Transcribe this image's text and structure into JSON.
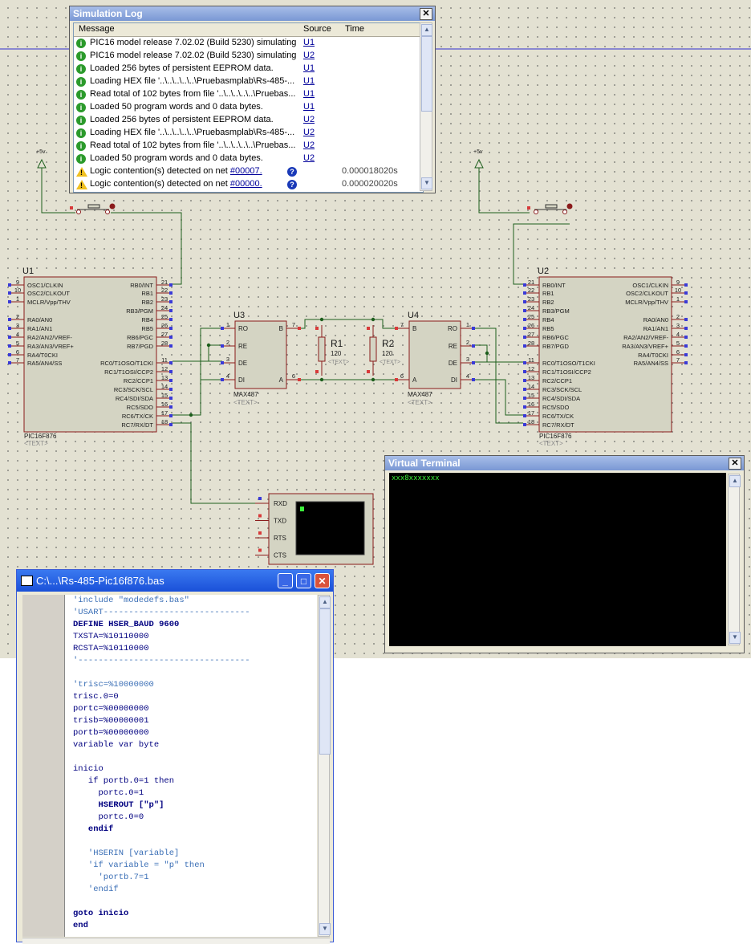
{
  "simlog": {
    "title": "Simulation Log",
    "headers": {
      "message": "Message",
      "source": "Source",
      "time": "Time"
    },
    "rows": [
      {
        "type": "info",
        "message": "PIC16 model release 7.02.02 (Build 5230) simulating ...",
        "source": "U1",
        "time": ""
      },
      {
        "type": "info",
        "message": "PIC16 model release 7.02.02 (Build 5230) simulating ...",
        "source": "U2",
        "time": ""
      },
      {
        "type": "info",
        "message": "Loaded 256 bytes of persistent EEPROM data.",
        "source": "U1",
        "time": ""
      },
      {
        "type": "info",
        "message": "Loading HEX file '..\\..\\..\\..\\..\\Pruebasmplab\\Rs-485-...",
        "source": "U1",
        "time": ""
      },
      {
        "type": "info",
        "message": "Read total of 102 bytes from file '..\\..\\..\\..\\..\\Pruebas...",
        "source": "U1",
        "time": ""
      },
      {
        "type": "info",
        "message": "Loaded 50 program words and 0 data bytes.",
        "source": "U1",
        "time": ""
      },
      {
        "type": "info",
        "message": "Loaded 256 bytes of persistent EEPROM data.",
        "source": "U2",
        "time": ""
      },
      {
        "type": "info",
        "message": "Loading HEX file '..\\..\\..\\..\\..\\Pruebasmplab\\Rs-485-...",
        "source": "U2",
        "time": ""
      },
      {
        "type": "info",
        "message": "Read total of 102 bytes from file '..\\..\\..\\..\\..\\Pruebas...",
        "source": "U2",
        "time": ""
      },
      {
        "type": "info",
        "message": "Loaded 50 program words and 0 data bytes.",
        "source": "U2",
        "time": ""
      },
      {
        "type": "warn",
        "message": "Logic contention(s) detected on net",
        "net": "#00007.",
        "source": "",
        "time": "0.000018020s"
      },
      {
        "type": "warn",
        "message": "Logic contention(s) detected on net",
        "net": "#00000.",
        "source": "",
        "time": "0.000020020s"
      }
    ]
  },
  "schematic": {
    "u1": {
      "ref": "U1",
      "part": "PIC16F876",
      "text": "<TEXT>",
      "left_pins": [
        {
          "num": "9",
          "name": "OSC1/CLKIN"
        },
        {
          "num": "10",
          "name": "OSC2/CLKOUT"
        },
        {
          "num": "1",
          "name": "MCLR/Vpp/THV"
        },
        {
          "num": "2",
          "name": "RA0/AN0"
        },
        {
          "num": "3",
          "name": "RA1/AN1"
        },
        {
          "num": "4",
          "name": "RA2/AN2/VREF-"
        },
        {
          "num": "5",
          "name": "RA3/AN3/VREF+"
        },
        {
          "num": "6",
          "name": "RA4/T0CKI"
        },
        {
          "num": "7",
          "name": "RA5/AN4/SS"
        }
      ],
      "right_pins": [
        {
          "num": "21",
          "name": "RB0/INT"
        },
        {
          "num": "22",
          "name": "RB1"
        },
        {
          "num": "23",
          "name": "RB2"
        },
        {
          "num": "24",
          "name": "RB3/PGM"
        },
        {
          "num": "25",
          "name": "RB4"
        },
        {
          "num": "26",
          "name": "RB5"
        },
        {
          "num": "27",
          "name": "RB6/PGC"
        },
        {
          "num": "28",
          "name": "RB7/PGD"
        },
        {
          "num": "11",
          "name": "RC0/T1OSO/T1CKI"
        },
        {
          "num": "12",
          "name": "RC1/T1OSI/CCP2"
        },
        {
          "num": "13",
          "name": "RC2/CCP1"
        },
        {
          "num": "14",
          "name": "RC3/SCK/SCL"
        },
        {
          "num": "15",
          "name": "RC4/SDI/SDA"
        },
        {
          "num": "16",
          "name": "RC5/SDO"
        },
        {
          "num": "17",
          "name": "RC6/TX/CK"
        },
        {
          "num": "18",
          "name": "RC7/RX/DT"
        }
      ]
    },
    "u2": {
      "ref": "U2",
      "part": "PIC16F876",
      "text": "<TEXT>"
    },
    "u3": {
      "ref": "U3",
      "part": "MAX487",
      "text": "<TEXT>",
      "left_pins": [
        {
          "num": "1",
          "name": "RO"
        },
        {
          "num": "2",
          "name": "RE"
        },
        {
          "num": "3",
          "name": "DE"
        },
        {
          "num": "4",
          "name": "DI"
        }
      ],
      "right_pins": [
        {
          "num": "7",
          "name": "B"
        },
        {
          "num": "6",
          "name": "A"
        }
      ]
    },
    "u4": {
      "ref": "U4",
      "part": "MAX487",
      "text": "<TEXT>",
      "left_pins": [
        {
          "num": "7",
          "name": "B"
        },
        {
          "num": "6",
          "name": "A"
        }
      ],
      "right_pins": [
        {
          "num": "1",
          "name": "RO"
        },
        {
          "num": "2",
          "name": "RE"
        },
        {
          "num": "3",
          "name": "DE"
        },
        {
          "num": "4",
          "name": "DI"
        }
      ]
    },
    "r1": {
      "ref": "R1",
      "value": "120",
      "text": "<TEXT>"
    },
    "r2": {
      "ref": "R2",
      "value": "120",
      "text": "<TEXT>"
    },
    "power_label": "+5v",
    "vt_pins": [
      "RXD",
      "TXD",
      "RTS",
      "CTS"
    ]
  },
  "vterm": {
    "title": "Virtual Terminal",
    "output": "xxx8xxxxxxx"
  },
  "editor": {
    "title": "C:\\...\\Rs-485-Pic16f876.bas",
    "lines": [
      "'include \"modedefs.bas\"",
      "'USART-----------------------------",
      "DEFINE HSER_BAUD 9600",
      "TXSTA=%10110000",
      "RCSTA=%10110000",
      "'----------------------------------",
      "",
      "'trisc=%10000000",
      "trisc.0=0",
      "portc=%00000000",
      "trisb=%00000001",
      "portb=%00000000",
      "variable var byte",
      "",
      "inicio",
      "   if portb.0=1 then",
      "     portc.0=1",
      "     HSEROUT [\"p\"]",
      "     portc.0=0",
      "   endif",
      "",
      "   'HSERIN [variable]",
      "   'if variable = \"p\" then",
      "     'portb.7=1",
      "   'endif",
      "",
      "goto inicio",
      "end"
    ]
  }
}
